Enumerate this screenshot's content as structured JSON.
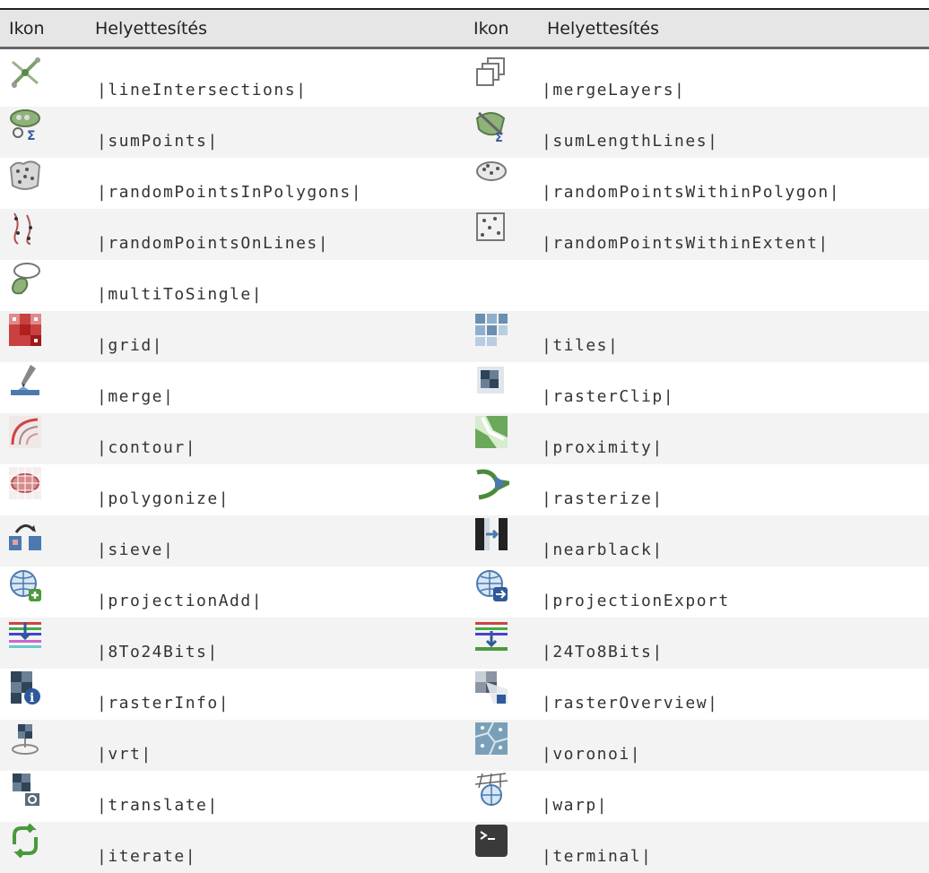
{
  "header": {
    "icon_col": "Ikon",
    "text_col": "Helyettesítés"
  },
  "rows": [
    {
      "left_icon": "line-intersections-icon",
      "left": "|lineIntersections|",
      "right_icon": "merge-layers-icon",
      "right": "|mergeLayers|"
    },
    {
      "left_icon": "sum-points-icon",
      "left": "|sumPoints|",
      "right_icon": "sum-length-lines-icon",
      "right": "|sumLengthLines|"
    },
    {
      "left_icon": "random-points-in-polygons-icon",
      "left": "|randomPointsInPolygons|",
      "right_icon": "random-points-within-polygon-icon",
      "right": "|randomPointsWithinPolygon|"
    },
    {
      "left_icon": "random-points-on-lines-icon",
      "left": "|randomPointsOnLines|",
      "right_icon": "random-points-within-extent-icon",
      "right": "|randomPointsWithinExtent|"
    },
    {
      "left_icon": "multi-to-single-icon",
      "left": "|multiToSingle|",
      "right_icon": "",
      "right": ""
    },
    {
      "left_icon": "grid-icon",
      "left": "|grid|",
      "right_icon": "tiles-icon",
      "right": "|tiles|"
    },
    {
      "left_icon": "merge-icon",
      "left": "|merge|",
      "right_icon": "raster-clip-icon",
      "right": "|rasterClip|"
    },
    {
      "left_icon": "contour-icon",
      "left": "|contour|",
      "right_icon": "proximity-icon",
      "right": "|proximity|"
    },
    {
      "left_icon": "polygonize-icon",
      "left": "|polygonize|",
      "right_icon": "rasterize-icon",
      "right": "|rasterize|"
    },
    {
      "left_icon": "sieve-icon",
      "left": "|sieve|",
      "right_icon": "nearblack-icon",
      "right": "|nearblack|"
    },
    {
      "left_icon": "projection-add-icon",
      "left": "|projectionAdd|",
      "right_icon": "projection-export-icon",
      "right": "|projectionExport"
    },
    {
      "left_icon": "8-to-24-bits-icon",
      "left": "|8To24Bits|",
      "right_icon": "24-to-8-bits-icon",
      "right": "|24To8Bits|"
    },
    {
      "left_icon": "raster-info-icon",
      "left": "|rasterInfo|",
      "right_icon": "raster-overview-icon",
      "right": "|rasterOverview|"
    },
    {
      "left_icon": "vrt-icon",
      "left": "|vrt|",
      "right_icon": "voronoi-icon",
      "right": "|voronoi|"
    },
    {
      "left_icon": "translate-icon",
      "left": "|translate|",
      "right_icon": "warp-icon",
      "right": "|warp|"
    },
    {
      "left_icon": "iterate-icon",
      "left": "|iterate|",
      "right_icon": "terminal-icon",
      "right": "|terminal|"
    }
  ]
}
